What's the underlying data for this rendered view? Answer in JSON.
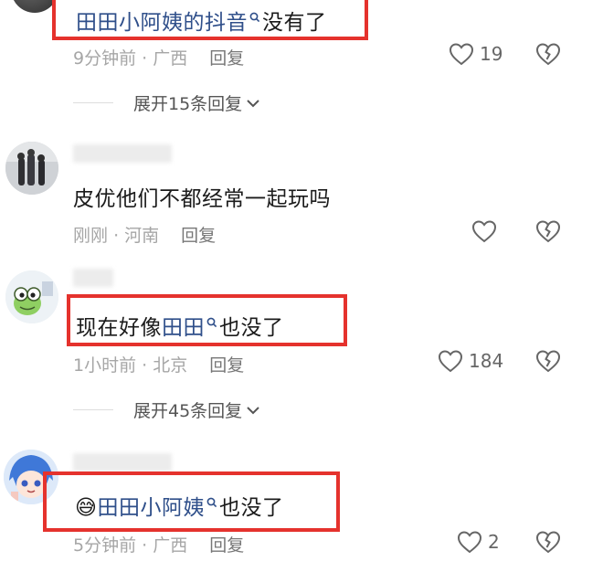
{
  "comments": [
    {
      "text_prefix": "",
      "link": "田田小阿姨的抖音",
      "text_suffix": "没有了",
      "time": "9分钟前",
      "location": "广西",
      "reply_label": "回复",
      "likes": "19",
      "expand_label": "展开15条回复"
    },
    {
      "text": "皮优他们不都经常一起玩吗",
      "time": "刚刚",
      "location": "河南",
      "reply_label": "回复",
      "likes": ""
    },
    {
      "text_prefix": "现在好像",
      "link": "田田",
      "text_suffix": "也没了",
      "time": "1小时前",
      "location": "北京",
      "reply_label": "回复",
      "likes": "184",
      "expand_label": "展开45条回复"
    },
    {
      "emoji": "😅",
      "link": "田田小阿姨",
      "text_suffix": "也没了",
      "time": "5分钟前",
      "location": "广西",
      "reply_label": "回复",
      "likes": "2"
    }
  ],
  "separator": "·",
  "colors": {
    "highlight_box": "#e5322d",
    "link": "#2f4f8a",
    "meta": "#a6a6a6"
  }
}
